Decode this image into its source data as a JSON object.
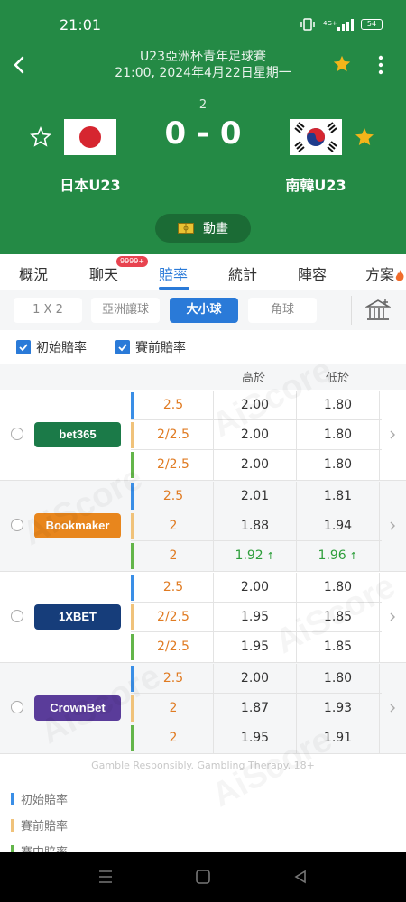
{
  "status_bar": {
    "time": "21:01",
    "battery": "54",
    "signal_label": "4G+"
  },
  "header": {
    "competition": "U23亞洲杯青年足球賽",
    "datetime": "21:00, 2024年4月22日星期一",
    "round": "2",
    "score": "0 - 0",
    "home_team": "日本U23",
    "away_team": "南韓U23",
    "animation_label": "動畫"
  },
  "tabs": [
    "概況",
    "聊天",
    "賠率",
    "統計",
    "陣容",
    "方案"
  ],
  "chat_badge": "9999+",
  "filters": [
    "1 X 2",
    "亞洲讓球",
    "大小球",
    "角球"
  ],
  "checks": [
    "初始賠率",
    "賽前賠率"
  ],
  "table_headers": {
    "over": "高於",
    "under": "低於"
  },
  "bookmakers": [
    {
      "name": "bet365",
      "color": "#1b7a48",
      "rows": [
        [
          "2.5",
          "2.00",
          "1.80"
        ],
        [
          "2/2.5",
          "2.00",
          "1.80"
        ],
        [
          "2/2.5",
          "2.00",
          "1.80"
        ]
      ]
    },
    {
      "name": "Bookmaker",
      "color": "#e8861d",
      "rows": [
        [
          "2.5",
          "2.01",
          "1.81"
        ],
        [
          "2",
          "1.88",
          "1.94"
        ],
        [
          "2",
          "1.92",
          "1.96"
        ]
      ]
    },
    {
      "name": "1XBET",
      "color": "#163d7a",
      "rows": [
        [
          "2.5",
          "2.00",
          "1.80"
        ],
        [
          "2/2.5",
          "1.95",
          "1.85"
        ],
        [
          "2/2.5",
          "1.95",
          "1.85"
        ]
      ]
    },
    {
      "name": "CrownBet",
      "color": "#5a3c9a",
      "rows": [
        [
          "2.5",
          "2.00",
          "1.80"
        ],
        [
          "2",
          "1.87",
          "1.93"
        ],
        [
          "2",
          "1.95",
          "1.91"
        ]
      ]
    }
  ],
  "colors": {
    "header_green": "#248a45",
    "accent_blue": "#2a7ad8",
    "handicap_orange": "#e07b22",
    "up_green": "#2e9e3b",
    "initial_bar": "#3a8ee6",
    "prematch_bar": "#f0c27a",
    "live_bar": "#63b54a"
  },
  "footer_note": "Gamble Responsibly. Gambling Therapy. 18+",
  "legend": [
    "初始賠率",
    "賽前賠率",
    "賽中賠率"
  ],
  "watermark": "AiScore"
}
